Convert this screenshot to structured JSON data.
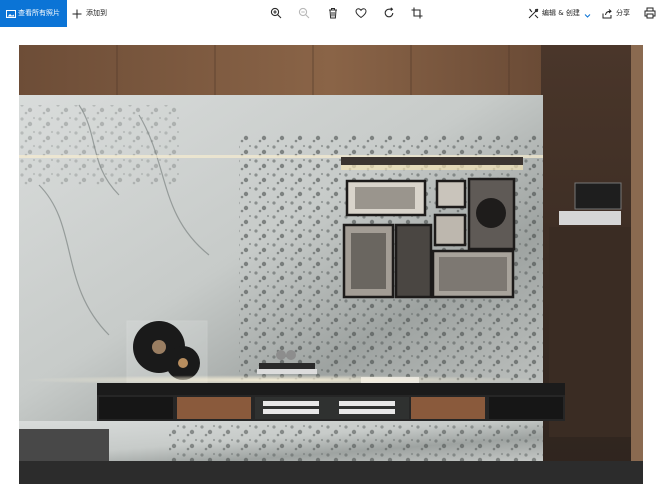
{
  "toolbar": {
    "view_all_label": "查看所有照片",
    "add_to_label": "添加到",
    "edit_create_label": "编辑 & 创建",
    "share_label": "分享",
    "tools": [
      "zoom-in",
      "zoom-out",
      "delete",
      "favorite",
      "rotate",
      "crop"
    ]
  },
  "colors": {
    "accent": "#0b74d6"
  }
}
